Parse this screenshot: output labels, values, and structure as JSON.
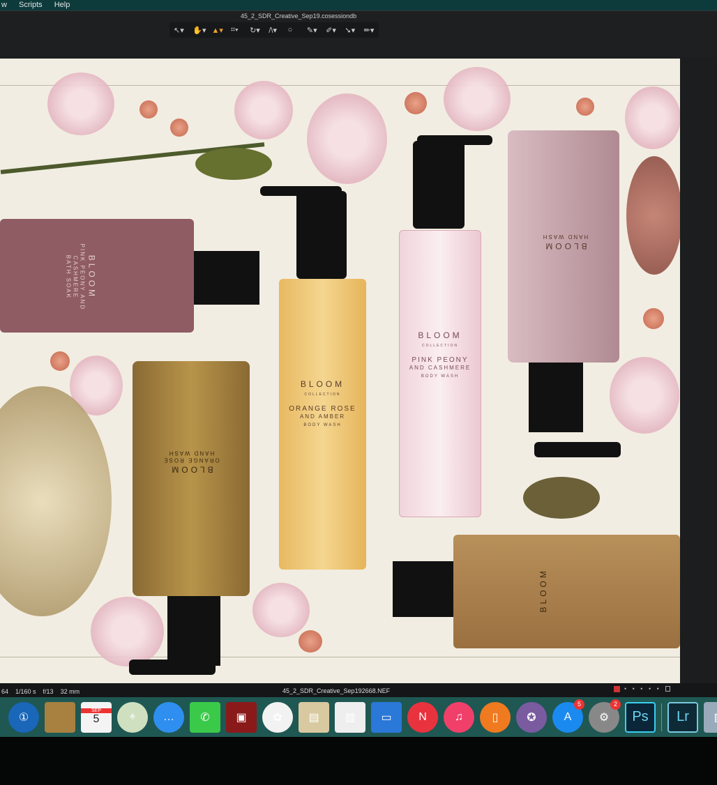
{
  "menubar": {
    "items": [
      "w",
      "Scripts",
      "Help"
    ]
  },
  "toolbar": {
    "session_title": "45_2_SDR_Creative_Sep19.cosessiondb",
    "tools": [
      {
        "icon": "select-icon",
        "glyph": "↖▾"
      },
      {
        "icon": "hand-icon",
        "glyph": "✋▾"
      },
      {
        "icon": "camera-icon",
        "glyph": "▲▾"
      },
      {
        "icon": "crop-icon",
        "glyph": "⌗▾"
      },
      {
        "icon": "rotate-icon",
        "glyph": "↻▾"
      },
      {
        "icon": "keystone-icon",
        "glyph": "/\\▾"
      },
      {
        "icon": "spot-icon",
        "glyph": "○"
      },
      {
        "icon": "brush-icon",
        "glyph": "✎▾"
      },
      {
        "icon": "pen-icon",
        "glyph": "✐▾"
      },
      {
        "icon": "picker-icon",
        "glyph": "➘▾"
      },
      {
        "icon": "annotate-icon",
        "glyph": "✏▾"
      }
    ]
  },
  "products": {
    "brand": "BLOOM",
    "collection": "COLLECTION",
    "orange": {
      "name1": "ORANGE ROSE",
      "name2": "AND AMBER",
      "type": "BODY WASH"
    },
    "pink": {
      "name1": "PINK PEONY",
      "name2": "AND CASHMERE",
      "type": "BODY WASH"
    },
    "soak": {
      "name1": "PINK PEONY",
      "name2": "AND CASHMERE",
      "type": "BATH SOAK"
    },
    "hand": {
      "type": "HAND WASH"
    }
  },
  "status": {
    "iso": "64",
    "shutter": "1/160 s",
    "aperture": "f/13",
    "focal": "32 mm",
    "filename": "45_2_SDR_Creative_Sep192668.NEF"
  },
  "dock": {
    "apps": [
      {
        "name": "1password",
        "label": "①",
        "color": "#1a66b8"
      },
      {
        "name": "contacts",
        "label": "",
        "color": "#a8803f"
      },
      {
        "name": "calendar",
        "label": "5",
        "month": "SEP",
        "color": "#f4f4f4"
      },
      {
        "name": "maps",
        "label": "⌖",
        "color": "#cfe0c0"
      },
      {
        "name": "messages",
        "label": "…",
        "color": "#2f8ff0"
      },
      {
        "name": "facetime",
        "label": "✆",
        "color": "#3bc94a"
      },
      {
        "name": "photo-booth",
        "label": "▣",
        "color": "#8a1a1a"
      },
      {
        "name": "photos",
        "label": "✿",
        "color": "#f2f2f2"
      },
      {
        "name": "preview",
        "label": "▤",
        "color": "#d9c9a0"
      },
      {
        "name": "numbers",
        "label": "▥",
        "color": "#eee"
      },
      {
        "name": "keynote",
        "label": "▭",
        "color": "#2a78d8"
      },
      {
        "name": "news",
        "label": "N",
        "color": "#e8333f"
      },
      {
        "name": "music",
        "label": "♫",
        "color": "#f0406a"
      },
      {
        "name": "books",
        "label": "▯",
        "color": "#f07a20"
      },
      {
        "name": "imovie",
        "label": "✪",
        "color": "#7a5ba0"
      },
      {
        "name": "app-store",
        "label": "A",
        "color": "#1a8af0",
        "badge": "5"
      },
      {
        "name": "system-preferences",
        "label": "⚙",
        "color": "#888",
        "badge": "2"
      },
      {
        "name": "photoshop",
        "label": "Ps",
        "color": "#0b2638"
      },
      {
        "name": "lightroom",
        "label": "Lr",
        "color": "#0e2a36"
      },
      {
        "name": "image-capture",
        "label": "▨",
        "color": "#9ab"
      }
    ]
  }
}
